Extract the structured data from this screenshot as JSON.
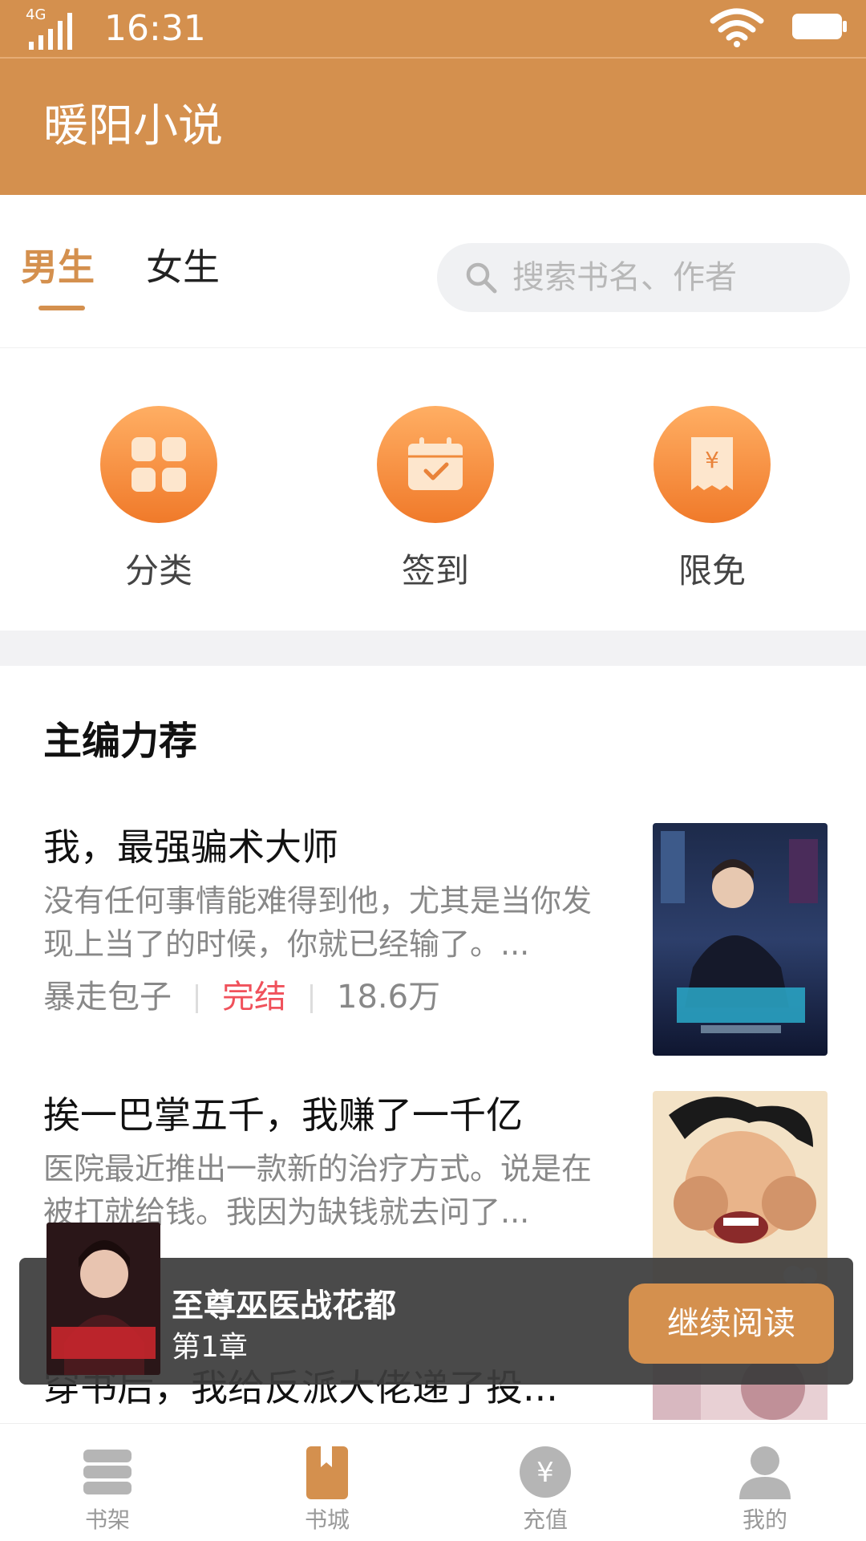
{
  "status_bar": {
    "network": "4G",
    "time": "16:31"
  },
  "app": {
    "title": "暖阳小说"
  },
  "tabs": [
    {
      "label": "男生",
      "active": true
    },
    {
      "label": "女生",
      "active": false
    }
  ],
  "search": {
    "placeholder": "搜索书名、作者"
  },
  "entries": [
    {
      "label": "分类",
      "icon": "grid-icon"
    },
    {
      "label": "签到",
      "icon": "calendar-check-icon"
    },
    {
      "label": "限免",
      "icon": "yuan-receipt-icon"
    }
  ],
  "section": {
    "title": "主编力荐"
  },
  "books": [
    {
      "title": "我，最强骗术大师",
      "desc": "没有任何事情能难得到他，尤其是当你发现上当了的时候，你就已经输了。...",
      "author": "暴走包子",
      "status": "完结",
      "count": "18.6万"
    },
    {
      "title": "挨一巴掌五千，我赚了一千亿",
      "desc": "医院最近推出一款新的治疗方式。说是在被打就给钱。我因为缺钱就去问了..."
    },
    {
      "title": "穿书后，我给反派大佬递了投..."
    }
  ],
  "continue_reading": {
    "title": "至尊巫医战花都",
    "chapter": "第1章",
    "button": "继续阅读"
  },
  "bottom_nav": [
    {
      "label": "书架",
      "icon": "bookshelf-icon"
    },
    {
      "label": "书城",
      "icon": "bookstore-icon",
      "active": true
    },
    {
      "label": "充值",
      "icon": "yuan-coin-icon"
    },
    {
      "label": "我的",
      "icon": "user-icon"
    }
  ],
  "colors": {
    "accent": "#D4904E",
    "orange_gradient_top": "#ffae63",
    "orange_gradient_bottom": "#f07a2a",
    "status_red": "#f0515b"
  }
}
